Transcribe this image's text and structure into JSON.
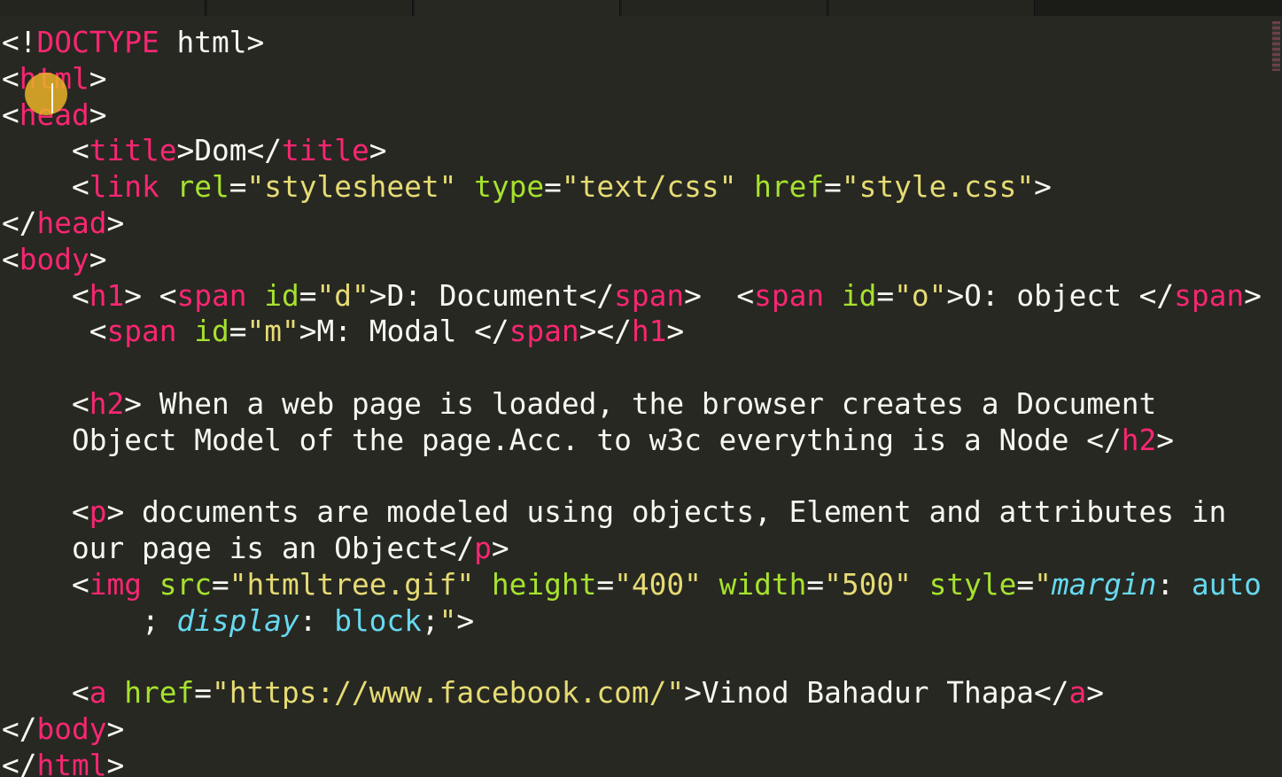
{
  "tabs": [
    {
      "label": "",
      "active": false
    },
    {
      "label": "",
      "active": false
    },
    {
      "label": "",
      "active": true
    },
    {
      "label": "",
      "active": false
    },
    {
      "label": "",
      "active": false
    }
  ],
  "colors": {
    "background": "#272822",
    "tag": "#f92672",
    "attribute": "#a6e22e",
    "string": "#e6db74",
    "css_property": "#66d9ef",
    "plain": "#f8f8f2",
    "cursor_highlight": "#eab228"
  },
  "code": [
    [
      [
        "p",
        "<!"
      ],
      [
        "tag",
        "DOCTYPE"
      ],
      [
        "text",
        " html"
      ],
      [
        "p",
        ">"
      ]
    ],
    [
      [
        "p",
        "<"
      ],
      [
        "tag",
        "html"
      ],
      [
        "p",
        ">"
      ]
    ],
    [
      [
        "p",
        "<"
      ],
      [
        "tag",
        "head"
      ],
      [
        "p",
        ">"
      ]
    ],
    [
      [
        "p",
        "    <"
      ],
      [
        "tag",
        "title"
      ],
      [
        "p",
        ">"
      ],
      [
        "text",
        "Dom"
      ],
      [
        "p",
        "</"
      ],
      [
        "tag",
        "title"
      ],
      [
        "p",
        ">"
      ]
    ],
    [
      [
        "p",
        "    <"
      ],
      [
        "tag",
        "link"
      ],
      [
        "p",
        " "
      ],
      [
        "attr",
        "rel"
      ],
      [
        "p",
        "="
      ],
      [
        "str",
        "\"stylesheet\""
      ],
      [
        "p",
        " "
      ],
      [
        "attr",
        "type"
      ],
      [
        "p",
        "="
      ],
      [
        "str",
        "\"text/css\""
      ],
      [
        "p",
        " "
      ],
      [
        "attr",
        "href"
      ],
      [
        "p",
        "="
      ],
      [
        "str",
        "\"style.css\""
      ],
      [
        "p",
        ">"
      ]
    ],
    [
      [
        "p",
        "</"
      ],
      [
        "tag",
        "head"
      ],
      [
        "p",
        ">"
      ]
    ],
    [
      [
        "p",
        "<"
      ],
      [
        "tag",
        "body"
      ],
      [
        "p",
        ">"
      ]
    ],
    [
      [
        "p",
        "    <"
      ],
      [
        "tag",
        "h1"
      ],
      [
        "p",
        ">"
      ],
      [
        "text",
        " "
      ],
      [
        "p",
        "<"
      ],
      [
        "tag",
        "span"
      ],
      [
        "p",
        " "
      ],
      [
        "attr",
        "id"
      ],
      [
        "p",
        "="
      ],
      [
        "str",
        "\"d\""
      ],
      [
        "p",
        ">"
      ],
      [
        "text",
        "D: Document"
      ],
      [
        "p",
        "</"
      ],
      [
        "tag",
        "span"
      ],
      [
        "p",
        ">"
      ],
      [
        "text",
        "  "
      ],
      [
        "p",
        "<"
      ],
      [
        "tag",
        "span"
      ],
      [
        "p",
        " "
      ],
      [
        "attr",
        "id"
      ],
      [
        "p",
        "="
      ],
      [
        "str",
        "\"o\""
      ],
      [
        "p",
        ">"
      ],
      [
        "text",
        "O: object "
      ],
      [
        "p",
        "</"
      ],
      [
        "tag",
        "span"
      ],
      [
        "p",
        ">"
      ]
    ],
    [
      [
        "text",
        "     "
      ],
      [
        "p",
        "<"
      ],
      [
        "tag",
        "span"
      ],
      [
        "p",
        " "
      ],
      [
        "attr",
        "id"
      ],
      [
        "p",
        "="
      ],
      [
        "str",
        "\"m\""
      ],
      [
        "p",
        ">"
      ],
      [
        "text",
        "M: Modal "
      ],
      [
        "p",
        "</"
      ],
      [
        "tag",
        "span"
      ],
      [
        "p",
        "></"
      ],
      [
        "tag",
        "h1"
      ],
      [
        "p",
        ">"
      ]
    ],
    [],
    [
      [
        "p",
        "    <"
      ],
      [
        "tag",
        "h2"
      ],
      [
        "p",
        ">"
      ],
      [
        "text",
        " When a web page is loaded, the browser creates a Document"
      ]
    ],
    [
      [
        "text",
        "    Object Model of the page.Acc. to w3c everything is a Node "
      ],
      [
        "p",
        "</"
      ],
      [
        "tag",
        "h2"
      ],
      [
        "p",
        ">"
      ]
    ],
    [],
    [
      [
        "p",
        "    <"
      ],
      [
        "tag",
        "p"
      ],
      [
        "p",
        ">"
      ],
      [
        "text",
        " documents are modeled using objects, Element and attributes in"
      ]
    ],
    [
      [
        "text",
        "    our page is an Object"
      ],
      [
        "p",
        "</"
      ],
      [
        "tag",
        "p"
      ],
      [
        "p",
        ">"
      ]
    ],
    [
      [
        "p",
        "    <"
      ],
      [
        "tag",
        "img"
      ],
      [
        "p",
        " "
      ],
      [
        "attr",
        "src"
      ],
      [
        "p",
        "="
      ],
      [
        "str",
        "\"htmltree.gif\""
      ],
      [
        "p",
        " "
      ],
      [
        "attr",
        "height"
      ],
      [
        "p",
        "="
      ],
      [
        "str",
        "\"400\""
      ],
      [
        "p",
        " "
      ],
      [
        "attr",
        "width"
      ],
      [
        "p",
        "="
      ],
      [
        "str",
        "\"500\""
      ],
      [
        "p",
        " "
      ],
      [
        "attr",
        "style"
      ],
      [
        "p",
        "="
      ],
      [
        "str",
        "\""
      ],
      [
        "prop",
        "margin"
      ],
      [
        "p",
        ": "
      ],
      [
        "val",
        "auto"
      ]
    ],
    [
      [
        "p",
        "        ; "
      ],
      [
        "prop",
        "display"
      ],
      [
        "p",
        ": "
      ],
      [
        "val",
        "block"
      ],
      [
        "p",
        ";"
      ],
      [
        "str",
        "\""
      ],
      [
        "p",
        ">"
      ]
    ],
    [],
    [
      [
        "p",
        "    <"
      ],
      [
        "tag",
        "a"
      ],
      [
        "p",
        " "
      ],
      [
        "attr",
        "href"
      ],
      [
        "p",
        "="
      ],
      [
        "str",
        "\"https://www.facebook.com/\""
      ],
      [
        "p",
        ">"
      ],
      [
        "text",
        "Vinod Bahadur Thapa"
      ],
      [
        "p",
        "</"
      ],
      [
        "tag",
        "a"
      ],
      [
        "p",
        ">"
      ]
    ],
    [
      [
        "p",
        "</"
      ],
      [
        "tag",
        "body"
      ],
      [
        "p",
        ">"
      ]
    ],
    [
      [
        "p",
        "</"
      ],
      [
        "tag",
        "html"
      ],
      [
        "p",
        ">"
      ]
    ]
  ]
}
